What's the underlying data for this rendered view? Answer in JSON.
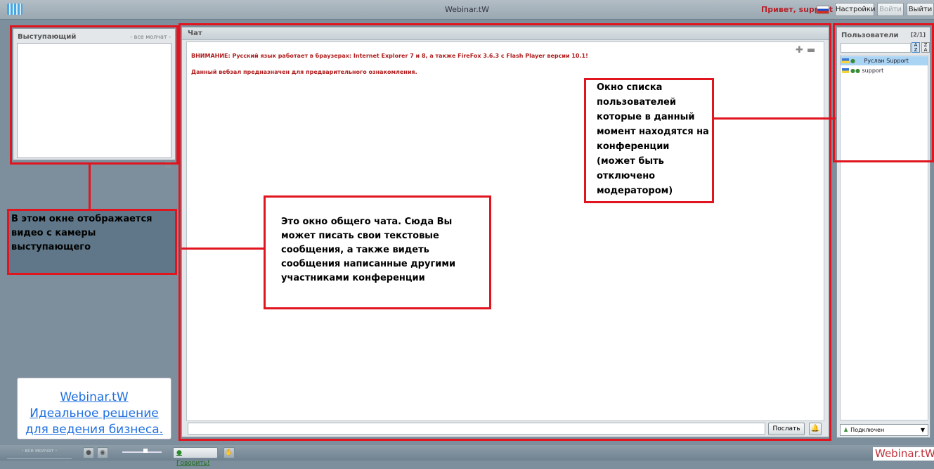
{
  "topbar": {
    "title": "Webinar.tW",
    "greeting": "Привет, support",
    "settings_label": "Настройки",
    "login_label": "Войти",
    "logout_label": "Выйти"
  },
  "speaker": {
    "title": "Выступающий",
    "status": "- все молчат -"
  },
  "chat": {
    "title": "Чат",
    "messages": [
      "ВНИМАНИЕ: Русский язык работает в браузерах: Internet Explorer 7 и 8, а также FireFox 3.6.3 с Flash Player версии 10.1!",
      "Данный вебзал предназначен для предварительного ознакомления."
    ],
    "send_label": "Послать"
  },
  "users": {
    "title": "Пользователи",
    "count": "[2/1]",
    "list": [
      {
        "name": "Руслан Support",
        "selected": true
      },
      {
        "name": "support",
        "selected": false
      }
    ],
    "status": "Подключен"
  },
  "annotations": {
    "speaker_note": "В этом окне отображается видео с камеры выступающего",
    "chat_note": "Это окно общего чата. Сюда Вы может писать свои текстовые сообщения, а также видеть сообщения написанные другими участниками конференции",
    "users_note": "Окно списка пользователей которые в данный момент находятся на конференции (может быть отключено модератором)"
  },
  "promo": {
    "line1": "Webinar.tW",
    "line2": "Идеальное решение",
    "line3": "для ведения бизнеса."
  },
  "bottombar": {
    "status": "- все молчат -",
    "speak_label": "Говорить!",
    "brand": "Webinar.tW",
    "volume_level": 0.6
  },
  "colors": {
    "annotation_red": "#e0151f",
    "alert_text": "#b01b1b",
    "selected_user": "#a9d4f3"
  },
  "icons": [
    "logo-icon",
    "flag-ru-icon",
    "video-settings-icon",
    "zoom-in-icon",
    "zoom-out-icon",
    "sound-icon",
    "sort-asc-icon",
    "sort-desc-icon",
    "mic-icon",
    "camera-icon",
    "hand-icon",
    "user-icon",
    "chevron-down-icon"
  ]
}
